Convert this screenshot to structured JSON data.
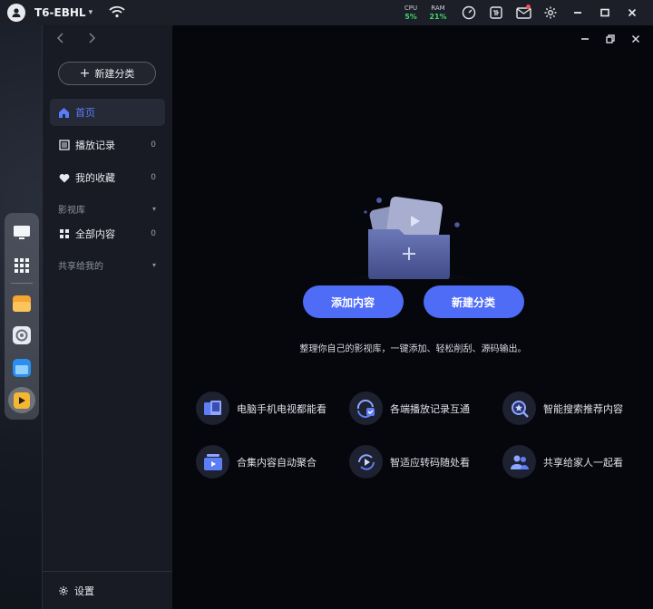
{
  "topbar": {
    "device_name": "T6-EBHL",
    "cpu": {
      "label": "CPU",
      "value": "5%"
    },
    "ram": {
      "label": "RAM",
      "value": "21%"
    },
    "icons": [
      "user-avatar-icon",
      "wifi-icon",
      "speedometer-icon",
      "remote-icon",
      "mail-icon",
      "gear-icon",
      "minimize-icon",
      "maximize-icon",
      "close-icon"
    ]
  },
  "dock": {
    "items": [
      "monitor-icon",
      "app-grid-icon",
      "file-manager-icon",
      "settings-app-icon",
      "photos-app-icon",
      "media-center-app-icon"
    ]
  },
  "sidebar": {
    "new_category_label": "新建分类",
    "items": [
      {
        "label": "首页",
        "icon": "home-icon"
      },
      {
        "label": "播放记录",
        "count": "0",
        "icon": "history-list-icon"
      },
      {
        "label": "我的收藏",
        "count": "0",
        "icon": "heart-icon"
      }
    ],
    "library_section": "影视库",
    "library_items": [
      {
        "label": "全部内容",
        "count": "0",
        "icon": "grid-icon"
      }
    ],
    "shared_section": "共享给我的",
    "footer_label": "设置"
  },
  "main": {
    "add_content_label": "添加内容",
    "new_category_label": "新建分类",
    "tagline": "整理你自己的影视库，一键添加、轻松削刮、源码输出。",
    "features": [
      {
        "label": "电脑手机电视都能看",
        "icon": "devices-icon"
      },
      {
        "label": "各端播放记录互通",
        "icon": "sync-history-icon"
      },
      {
        "label": "智能搜索推荐内容",
        "icon": "smart-search-icon"
      },
      {
        "label": "合集内容自动聚合",
        "icon": "collection-icon"
      },
      {
        "label": "智适应转码随处看",
        "icon": "transcode-icon"
      },
      {
        "label": "共享给家人一起看",
        "icon": "family-share-icon"
      }
    ]
  },
  "colors": {
    "accent": "#4f6cf6",
    "sidebar_bg": "#181b23",
    "main_bg": "#06070c"
  }
}
